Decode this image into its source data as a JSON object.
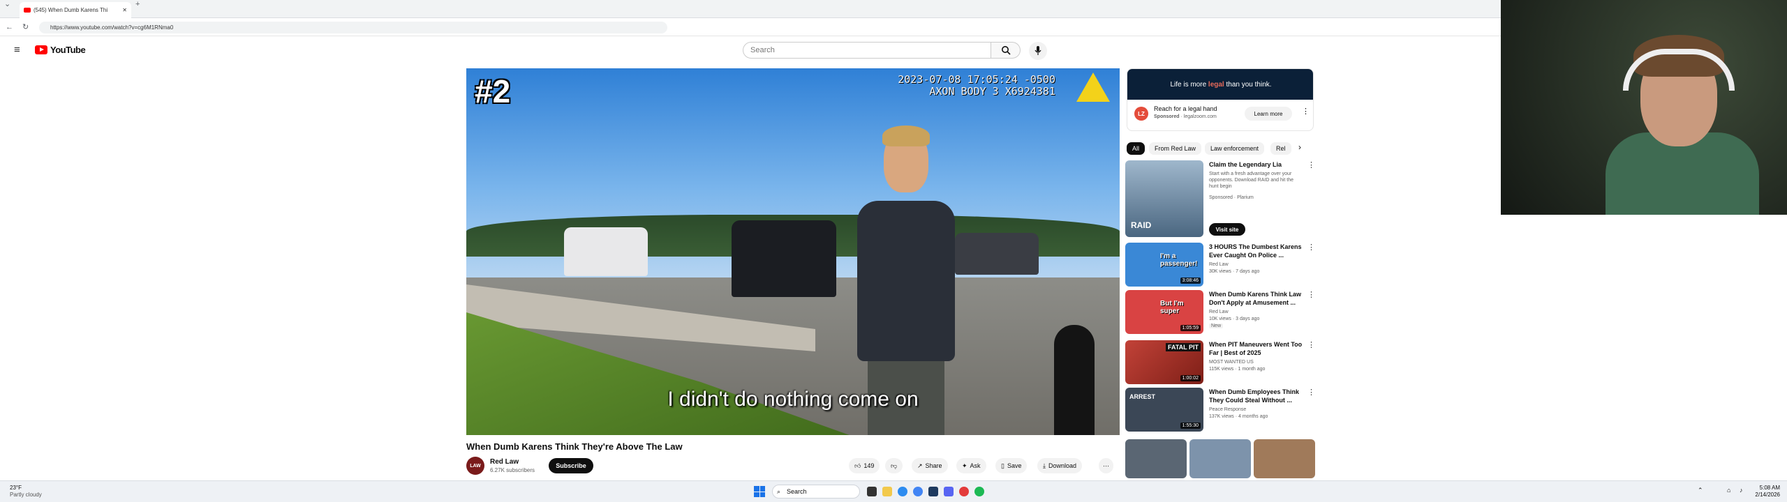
{
  "browser": {
    "tab_title": "(545) When Dumb Karens Thi",
    "url": "https://www.youtube.com/watch?v=cg6M1RNma0"
  },
  "youtube": {
    "logo_text": "YouTube",
    "search_placeholder": "Search"
  },
  "video": {
    "badge": "#2",
    "stamp_line1": "2023-07-08 17:05:24 -0500",
    "stamp_line2": "AXON BODY 3 X6924381",
    "caption": "I didn't do nothing come on",
    "title": "When Dumb Karens Think They're Above The Law",
    "channel": "Red Law",
    "avatar_text": "LAW",
    "subscribers": "6.27K subscribers",
    "subscribe_label": "Subscribe",
    "likes": "149",
    "share_label": "Share",
    "ask_label": "Ask",
    "save_label": "Save",
    "download_label": "Download"
  },
  "ad": {
    "banner_pre": "Life is more",
    "banner_highlight": "legal",
    "banner_post": "than you think.",
    "title": "Reach for a legal hand",
    "sponsored": "Sponsored",
    "domain": "legalzoom.com",
    "logo_text": "LZ",
    "learn_more": "Learn more"
  },
  "chips": [
    "All",
    "From Red Law",
    "Law enforcement",
    "Rel"
  ],
  "recommendations": [
    {
      "title": "Claim the Legendary Lia",
      "line2": "Start with a fresh advantage over your opponents. Download RAID and hit the hunt begin",
      "meta": "Sponsored · Plarium",
      "cta": "Visit site",
      "thumb_text": "RAID",
      "thumb_color": "#6a8fb0"
    },
    {
      "title": "3 HOURS The Dumbest Karens Ever Caught On Police ...",
      "channel": "Red Law",
      "meta": "30K views · 7 days ago",
      "duration": "3:08:46",
      "thumb_text": "I'm a passenger!",
      "thumb_color": "#3a88d6"
    },
    {
      "title": "When Dumb Karens Think Law Don't Apply at Amusement ...",
      "channel": "Red Law",
      "meta": "10K views · 3 days ago",
      "badge": "New",
      "duration": "1:05:59",
      "thumb_text": "But I'm super",
      "thumb_color": "#d94343"
    },
    {
      "title": "When PIT Maneuvers Went Too Far | Best of 2025",
      "channel": "MOST WANTED US",
      "meta": "115K views · 1 month ago",
      "duration": "1:00:02",
      "thumb_text": "FATAL PIT",
      "thumb_color": "#b5352b"
    },
    {
      "title": "When Dumb Employees Think They Could Steal Without ...",
      "channel": "Peace Response",
      "meta": "137K views · 4 months ago",
      "duration": "1:55:30",
      "thumb_text": "ARREST",
      "thumb_color": "#3b4756"
    }
  ],
  "taskbar": {
    "weather_temp": "23°F",
    "weather_desc": "Partly cloudy",
    "search_label": "Search",
    "time": "5:08 AM",
    "date": "2/14/2026"
  },
  "colors": {
    "yt_red": "#ff0000",
    "ad_navy": "#0b2038"
  }
}
